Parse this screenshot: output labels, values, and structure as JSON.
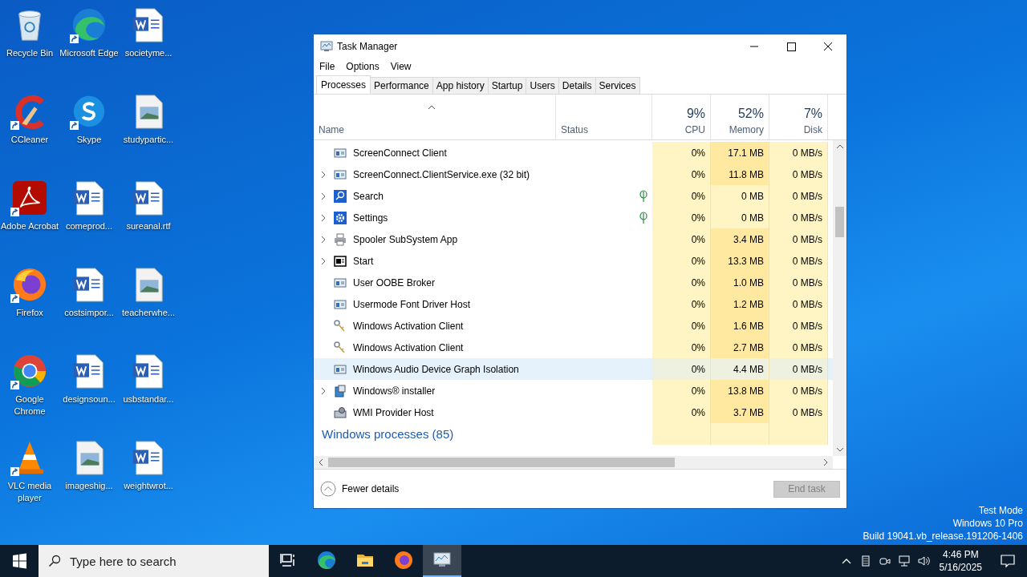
{
  "desktop_icons": [
    {
      "label": "Recycle Bin",
      "kind": "recycle",
      "shortcut": false
    },
    {
      "label": "CCleaner",
      "kind": "ccleaner",
      "shortcut": true
    },
    {
      "label": "Adobe Acrobat",
      "kind": "acrobat",
      "shortcut": true
    },
    {
      "label": "Firefox",
      "kind": "firefox",
      "shortcut": true
    },
    {
      "label": "Google Chrome",
      "kind": "chrome",
      "shortcut": true
    },
    {
      "label": "VLC media player",
      "kind": "vlc",
      "shortcut": true
    },
    {
      "label": "Microsoft Edge",
      "kind": "edge",
      "shortcut": true
    },
    {
      "label": "Skype",
      "kind": "skype",
      "shortcut": true
    },
    {
      "label": "comeprod...",
      "kind": "word",
      "shortcut": false
    },
    {
      "label": "costsimpor...",
      "kind": "word",
      "shortcut": false
    },
    {
      "label": "designsoun...",
      "kind": "word",
      "shortcut": false
    },
    {
      "label": "imageshig...",
      "kind": "image",
      "shortcut": false
    },
    {
      "label": "societyme...",
      "kind": "word",
      "shortcut": false
    },
    {
      "label": "studypartic...",
      "kind": "image",
      "shortcut": false
    },
    {
      "label": "sureanal.rtf",
      "kind": "word",
      "shortcut": false
    },
    {
      "label": "teacherwhe...",
      "kind": "image",
      "shortcut": false
    },
    {
      "label": "usbstandar...",
      "kind": "word",
      "shortcut": false
    },
    {
      "label": "weightwrot...",
      "kind": "word",
      "shortcut": false
    }
  ],
  "window": {
    "title": "Task Manager",
    "menu": [
      "File",
      "Options",
      "View"
    ],
    "tabs": [
      {
        "label": "Processes",
        "selected": true
      },
      {
        "label": "Performance",
        "selected": false
      },
      {
        "label": "App history",
        "selected": false
      },
      {
        "label": "Startup",
        "selected": false
      },
      {
        "label": "Users",
        "selected": false
      },
      {
        "label": "Details",
        "selected": false
      },
      {
        "label": "Services",
        "selected": false
      }
    ],
    "columns": [
      {
        "label": "Name"
      },
      {
        "label": "Status"
      },
      {
        "percent": "9%",
        "label": "CPU"
      },
      {
        "percent": "52%",
        "label": "Memory"
      },
      {
        "percent": "7%",
        "label": "Disk"
      }
    ],
    "rows": [
      {
        "name": "ScreenConnect Client",
        "kind": "app",
        "expandable": false,
        "suspended": false,
        "cpu": "0%",
        "memory": "17.1 MB",
        "memory_shaded": true,
        "disk": "0 MB/s",
        "selected": false
      },
      {
        "name": "ScreenConnect.ClientService.exe (32 bit)",
        "kind": "app",
        "expandable": true,
        "suspended": false,
        "cpu": "0%",
        "memory": "11.8 MB",
        "memory_shaded": true,
        "disk": "0 MB/s",
        "selected": false
      },
      {
        "name": "Search",
        "kind": "search",
        "expandable": true,
        "suspended": true,
        "cpu": "0%",
        "memory": "0 MB",
        "memory_shaded": false,
        "disk": "0 MB/s",
        "selected": false
      },
      {
        "name": "Settings",
        "kind": "settings",
        "expandable": true,
        "suspended": true,
        "cpu": "0%",
        "memory": "0 MB",
        "memory_shaded": false,
        "disk": "0 MB/s",
        "selected": false
      },
      {
        "name": "Spooler SubSystem App",
        "kind": "printer",
        "expandable": true,
        "suspended": false,
        "cpu": "0%",
        "memory": "3.4 MB",
        "memory_shaded": true,
        "disk": "0 MB/s",
        "selected": false
      },
      {
        "name": "Start",
        "kind": "start",
        "expandable": true,
        "suspended": false,
        "cpu": "0%",
        "memory": "13.3 MB",
        "memory_shaded": true,
        "disk": "0 MB/s",
        "selected": false
      },
      {
        "name": "User OOBE Broker",
        "kind": "app",
        "expandable": false,
        "suspended": false,
        "cpu": "0%",
        "memory": "1.0 MB",
        "memory_shaded": true,
        "disk": "0 MB/s",
        "selected": false
      },
      {
        "name": "Usermode Font Driver Host",
        "kind": "app",
        "expandable": false,
        "suspended": false,
        "cpu": "0%",
        "memory": "1.2 MB",
        "memory_shaded": true,
        "disk": "0 MB/s",
        "selected": false
      },
      {
        "name": "Windows Activation Client",
        "kind": "keys",
        "expandable": false,
        "suspended": false,
        "cpu": "0%",
        "memory": "1.6 MB",
        "memory_shaded": true,
        "disk": "0 MB/s",
        "selected": false
      },
      {
        "name": "Windows Activation Client",
        "kind": "keys",
        "expandable": false,
        "suspended": false,
        "cpu": "0%",
        "memory": "2.7 MB",
        "memory_shaded": true,
        "disk": "0 MB/s",
        "selected": false
      },
      {
        "name": "Windows Audio Device Graph Isolation",
        "kind": "app",
        "expandable": false,
        "suspended": false,
        "cpu": "0%",
        "memory": "4.4 MB",
        "memory_shaded": true,
        "disk": "0 MB/s",
        "selected": true
      },
      {
        "name": "Windows® installer",
        "kind": "installer",
        "expandable": true,
        "suspended": false,
        "cpu": "0%",
        "memory": "13.8 MB",
        "memory_shaded": true,
        "disk": "0 MB/s",
        "selected": false
      },
      {
        "name": "WMI Provider Host",
        "kind": "wmi",
        "expandable": false,
        "suspended": false,
        "cpu": "0%",
        "memory": "3.7 MB",
        "memory_shaded": true,
        "disk": "0 MB/s",
        "selected": false
      }
    ],
    "group_header": "Windows processes (85)",
    "fewer_details": "Fewer details",
    "end_task": {
      "label": "End task",
      "disabled": true
    }
  },
  "system_text": [
    "Test Mode",
    "Windows 10 Pro",
    "Build 19041.vb_release.191206-1406"
  ],
  "taskbar": {
    "search_placeholder": "Type here to search",
    "apps": [
      {
        "kind": "taskview",
        "selected": false
      },
      {
        "kind": "edge",
        "selected": false
      },
      {
        "kind": "explorer",
        "selected": false
      },
      {
        "kind": "firefox",
        "selected": false
      },
      {
        "kind": "taskmanager",
        "selected": true
      }
    ],
    "time": "4:46 PM",
    "date": "5/16/2025"
  }
}
